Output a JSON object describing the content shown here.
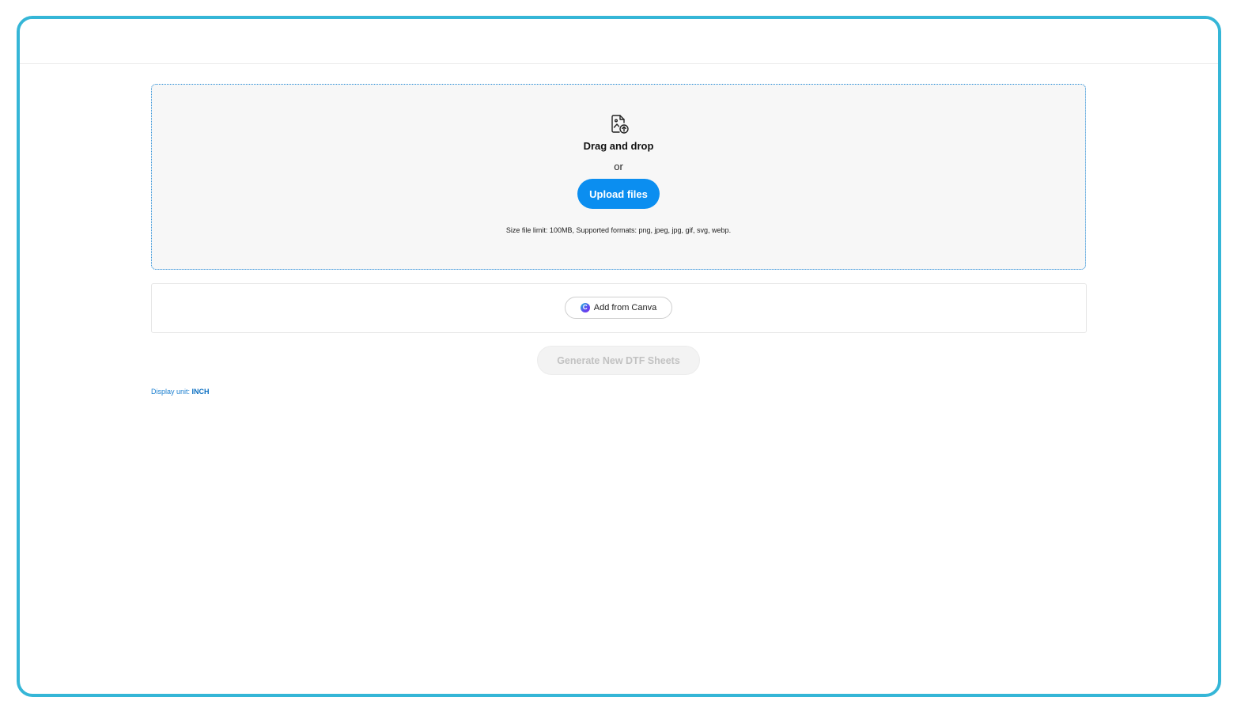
{
  "dropzone": {
    "icon": "image-upload-icon",
    "title": "Drag and drop",
    "or_text": "or",
    "upload_label": "Upload files",
    "limit_text": "Size file limit: 100MB, Supported formats: png, jpeg, jpg, gif, svg, webp."
  },
  "canva": {
    "icon": "canva-logo-icon",
    "label": "Add from Canva"
  },
  "generate": {
    "label": "Generate New DTF Sheets",
    "enabled": false
  },
  "display_unit": {
    "label": "Display unit:",
    "value": "INCH"
  },
  "colors": {
    "frame_border": "#35b6d7",
    "accent": "#0b8ef0",
    "dropzone_border": "#1e88d6",
    "disabled_text": "#c2c2c2"
  }
}
